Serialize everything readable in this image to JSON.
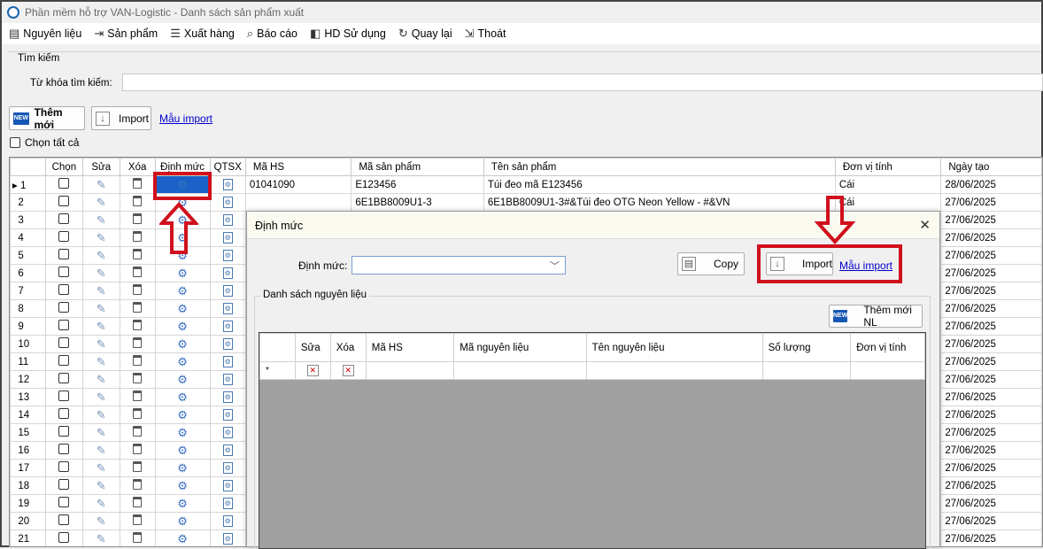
{
  "window": {
    "title": "Phần mềm hỗ trợ VAN-Logistic - Danh sách sản phẩm xuất"
  },
  "menu": [
    {
      "label": "Nguyên liệu",
      "icon": "document-icon"
    },
    {
      "label": "Sản phẩm",
      "icon": "export-icon"
    },
    {
      "label": "Xuất hàng",
      "icon": "list-icon"
    },
    {
      "label": "Báo cáo",
      "icon": "magnifier-icon"
    },
    {
      "label": "HD Sử dụng",
      "icon": "help-icon"
    },
    {
      "label": "Quay lại",
      "icon": "refresh-icon"
    },
    {
      "label": "Thoát",
      "icon": "exit-icon"
    }
  ],
  "search": {
    "group_label": "Tìm kiếm",
    "keyword_label": "Từ khóa tìm kiếm:",
    "keyword_value": ""
  },
  "toolbar": {
    "new_label": "Thêm mới",
    "new_icon_text": "NEW",
    "import_label": "Import",
    "template_link": "Mẫu import"
  },
  "select_all_label": "Chọn tất cả",
  "grid": {
    "headers": [
      "Chọn",
      "Sửa",
      "Xóa",
      "Định mức",
      "QTSX",
      "Mã HS",
      "Mã sản phẩm",
      "Tên sản phẩm",
      "Đơn vị tính",
      "Ngày tạo"
    ],
    "rows": [
      {
        "n": "1",
        "hs": "01041090",
        "code": "E123456",
        "name": "Túi đeo mã E123456",
        "unit": "Cái",
        "date": "28/06/2025"
      },
      {
        "n": "2",
        "hs": "",
        "code": "6E1BB8009U1-3",
        "name": "6E1BB8009U1-3#&Túi đeo  OTG  Neon Yellow - #&VN",
        "unit": "Cái",
        "date": "27/06/2025"
      },
      {
        "n": "3",
        "hs": "",
        "code": "",
        "name": "",
        "unit": "",
        "date": "27/06/2025"
      },
      {
        "n": "4",
        "hs": "",
        "code": "",
        "name": "",
        "unit": "",
        "date": "27/06/2025"
      },
      {
        "n": "5",
        "hs": "",
        "code": "",
        "name": "",
        "unit": "",
        "date": "27/06/2025"
      },
      {
        "n": "6",
        "hs": "",
        "code": "",
        "name": "",
        "unit": "",
        "date": "27/06/2025"
      },
      {
        "n": "7",
        "hs": "",
        "code": "",
        "name": "",
        "unit": "",
        "date": "27/06/2025"
      },
      {
        "n": "8",
        "hs": "",
        "code": "",
        "name": "",
        "unit": "",
        "date": "27/06/2025"
      },
      {
        "n": "9",
        "hs": "",
        "code": "",
        "name": "",
        "unit": "",
        "date": "27/06/2025"
      },
      {
        "n": "10",
        "hs": "",
        "code": "",
        "name": "",
        "unit": "",
        "date": "27/06/2025"
      },
      {
        "n": "11",
        "hs": "",
        "code": "",
        "name": "",
        "unit": "",
        "date": "27/06/2025"
      },
      {
        "n": "12",
        "hs": "",
        "code": "",
        "name": "",
        "unit": "",
        "date": "27/06/2025"
      },
      {
        "n": "13",
        "hs": "",
        "code": "",
        "name": "",
        "unit": "",
        "date": "27/06/2025"
      },
      {
        "n": "14",
        "hs": "",
        "code": "",
        "name": "",
        "unit": "",
        "date": "27/06/2025"
      },
      {
        "n": "15",
        "hs": "",
        "code": "",
        "name": "",
        "unit": "",
        "date": "27/06/2025"
      },
      {
        "n": "16",
        "hs": "",
        "code": "",
        "name": "",
        "unit": "",
        "date": "27/06/2025"
      },
      {
        "n": "17",
        "hs": "",
        "code": "",
        "name": "",
        "unit": "",
        "date": "27/06/2025"
      },
      {
        "n": "18",
        "hs": "",
        "code": "",
        "name": "",
        "unit": "",
        "date": "27/06/2025"
      },
      {
        "n": "19",
        "hs": "",
        "code": "",
        "name": "",
        "unit": "",
        "date": "27/06/2025"
      },
      {
        "n": "20",
        "hs": "",
        "code": "",
        "name": "",
        "unit": "",
        "date": "27/06/2025"
      },
      {
        "n": "21",
        "hs": "",
        "code": "",
        "name": "",
        "unit": "",
        "date": "27/06/2025"
      }
    ]
  },
  "dialog": {
    "title": "Định mức",
    "close_glyph": "✕",
    "dinh_muc_label": "Định mức:",
    "dinh_muc_value": "",
    "copy_label": "Copy",
    "import_label": "Import",
    "template_link": "Mẫu import",
    "group_label": "Danh sách nguyên liệu",
    "add_material_label": "Thêm mới NL",
    "grid_headers": [
      "Sửa",
      "Xóa",
      "Mã HS",
      "Mã nguyên liệu",
      "Tên nguyên liệu",
      "Số lượng",
      "Đơn vị tính"
    ],
    "new_row_marker": "*"
  },
  "colors": {
    "highlight": "#d0101c",
    "selection": "#1a62c7",
    "link": "#0000cc"
  }
}
